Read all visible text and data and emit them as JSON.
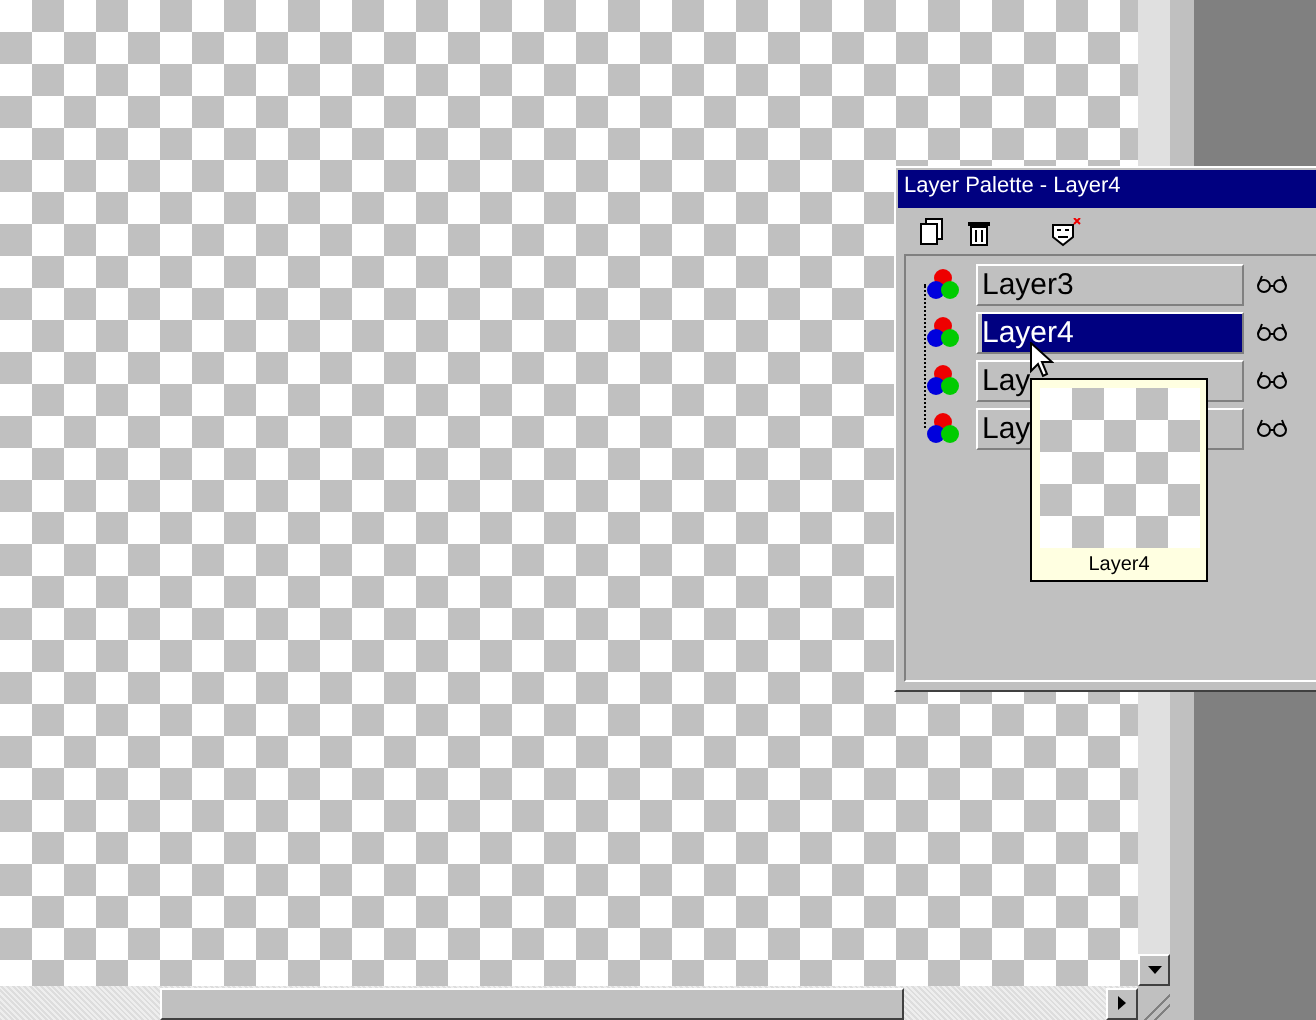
{
  "palette": {
    "title": "Layer Palette - Layer4",
    "layers": [
      {
        "name": "Layer3",
        "selected": false
      },
      {
        "name": "Layer4",
        "selected": true
      },
      {
        "name": "Lay",
        "selected": false
      },
      {
        "name": "Lay",
        "selected": false
      }
    ],
    "tooltip": {
      "label": "Layer4"
    }
  }
}
